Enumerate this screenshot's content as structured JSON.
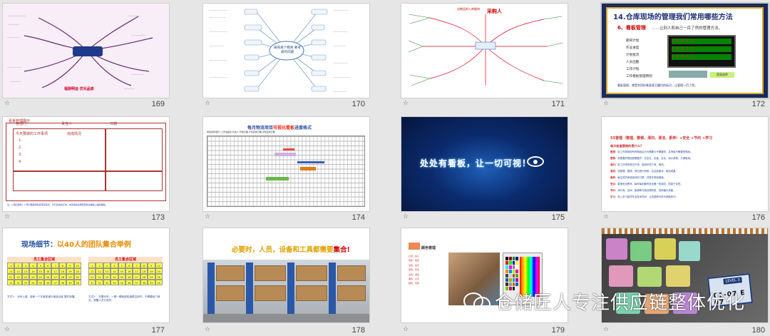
{
  "slides": [
    {
      "num": "169",
      "caption": "福驰明运 优化品质"
    },
    {
      "num": "170",
      "center": "采购某个物资 要考虑的问题",
      "nodes": [
        "价格",
        "付款方式",
        "采购流程",
        "质量保证",
        "交货期",
        "供应商",
        "运输",
        "包装",
        "库存",
        "检验",
        "合同",
        "售后"
      ]
    },
    {
      "num": "171",
      "title": "出物品的入库维持",
      "mark": "采购人"
    },
    {
      "num": "172",
      "title": "14.仓库现场的管理我们常用哪些方法",
      "sub": "6、看板管理",
      "sub2": "……让别人和自己一目了然的管理方法。",
      "list": [
        "期间计划",
        "作业进度",
        "计划批次",
        "人员出勤",
        "工作计划",
        "工作看板管理原则"
      ],
      "board": [
        "8 8 8 8 8",
        "8 8 8 8 8",
        "8 8 8 8 8"
      ],
      "green": "提高效率",
      "foot": "看板管理，就是利用形象直观又醒目的标识，让管理一目了然。"
    },
    {
      "num": "173",
      "header": "看板管理展示",
      "rows": [
        "今天要做的工作事项",
        "1.",
        "2.",
        "3.",
        "4."
      ],
      "labels": [
        "各部门",
        "责任人",
        "日期"
      ],
      "status": "完成情况",
      "foot": "注：1.每日更新；2.按日期逐项检查落实情况，对已完成的打钩，未完成的注明原因并在看板上继续跟踪。"
    },
    {
      "num": "174",
      "title_pre": "每月物流项目",
      "title_hi": "可视化看板",
      "title_post": "进度格式",
      "header": "项目名称/部门  工作进度表  负责人  开始日期  计划完成日期  实际完成日期"
    },
    {
      "num": "175",
      "text": "处处有看板，让一切可视！"
    },
    {
      "num": "176",
      "title": "5S管理（整理、整顿、清扫、清洁、素养）+安全 +节约 +学习",
      "q": "每天检查要做的是什么?",
      "lines": [
        {
          "k": "整理：",
          "v": "将工作现场的所有物品区分为需要与不需要的，并清除不需要的物品。"
        },
        {
          "k": "整顿：",
          "v": "将需要的物品放置整齐，并定位、定量、定名、标示清楚，方便取用。"
        },
        {
          "k": "清扫：",
          "v": "将工作场所清扫干净，保持环境干净、明亮。"
        },
        {
          "k": "清洁：",
          "v": "将整理、整顿、清扫进行到底，并且制度化，维持成果。"
        },
        {
          "k": "素养：",
          "v": "每位成员养成良好的习惯，并遵守规则做事。"
        },
        {
          "k": "安全：",
          "v": "重视安全教育，每时每刻都有安全第一的观念，防患于未然。"
        },
        {
          "k": "节约：",
          "v": "对时间、空间、能源等方面合理利用，发挥最大效能。"
        },
        {
          "k": "学习：",
          "v": "深入学习各项专业技术知识，从实践和书本中获取知识。"
        }
      ]
    },
    {
      "num": "177",
      "title_pre": "现场细节：",
      "title_hi": "以40人的团队集合举例",
      "box_title": "员工集合区域",
      "left_note": "方式1：\n对号入座，谁和一个字就知道与他接近谁 暂时放置。",
      "right_note": "方式2：\n无需对号，一看一眼就能知道是否到齐，不需要逐个核对。提醒人员已到齐。"
    },
    {
      "num": "178",
      "title_pre": "必要时，人员，设备和工具都需要",
      "title_hi": "集合!"
    },
    {
      "num": "179",
      "title": "颜色管理",
      "lines": [
        "红色：禁止",
        "黄色：警告",
        "蓝色：指示",
        "绿色：安全",
        "白色：通道",
        "黑色：文字",
        "橙色：危险"
      ]
    },
    {
      "num": "180",
      "label_level": "LEVEL 3",
      "label_code": "01-07 E 07"
    }
  ],
  "watermark": "仓储匠人专注供应链整体优化"
}
